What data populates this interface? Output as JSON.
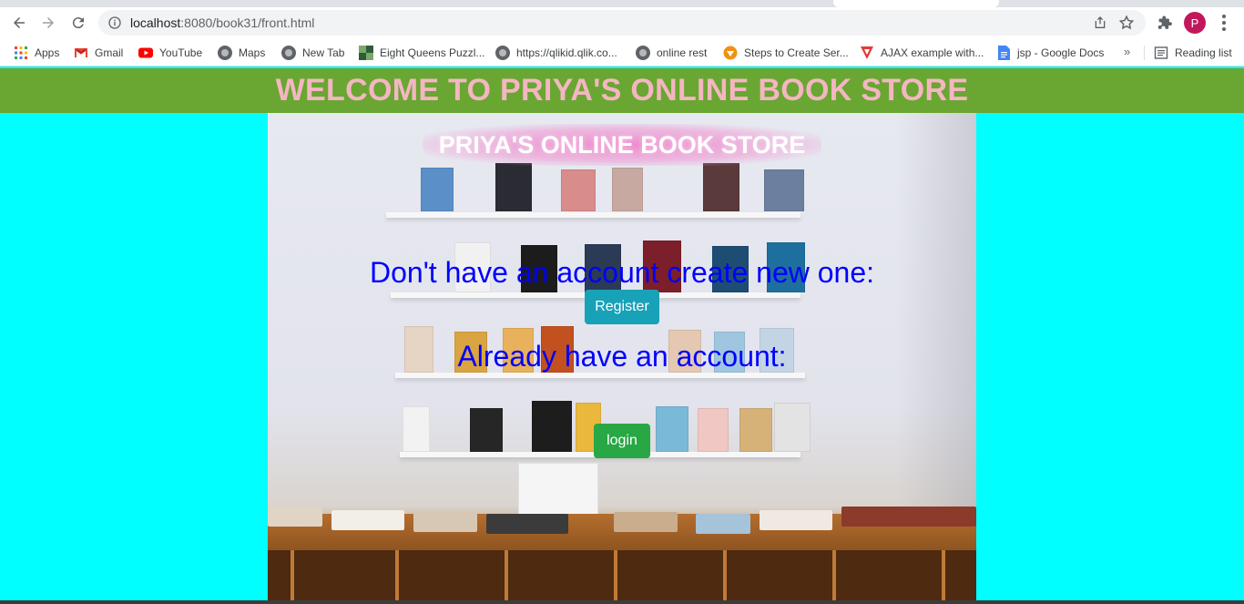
{
  "browser": {
    "url_host": "localhost",
    "url_path": ":8080/book31/front.html",
    "profile_initial": "P"
  },
  "bookmarks": [
    {
      "label": "Apps",
      "icon": "apps-grid-icon"
    },
    {
      "label": "Gmail",
      "icon": "gmail-icon"
    },
    {
      "label": "YouTube",
      "icon": "youtube-icon"
    },
    {
      "label": "Maps",
      "icon": "globe-icon"
    },
    {
      "label": "New Tab",
      "icon": "globe-icon"
    },
    {
      "label": "Eight Queens Puzzl...",
      "icon": "site-icon"
    },
    {
      "label": "https://qlikid.qlik.co...",
      "icon": "globe-icon"
    },
    {
      "label": "online rest",
      "icon": "globe-icon"
    },
    {
      "label": "Steps to Create Ser...",
      "icon": "site-icon"
    },
    {
      "label": "AJAX example with...",
      "icon": "site-icon"
    },
    {
      "label": "jsp - Google Docs",
      "icon": "google-docs-icon"
    }
  ],
  "bookmarks_more": "»",
  "reading_list": "Reading list",
  "page": {
    "banner_title": "WELCOME TO PRIYA'S ONLINE BOOK STORE",
    "hero_title": "PRIYA'S ONLINE BOOK STORE",
    "register_prompt": "Don't have an account create new one:",
    "register_button": "Register",
    "login_prompt": "Already have an account:",
    "login_button": "login"
  },
  "colors": {
    "page_background": "#00ffff",
    "banner_background": "#6aa632",
    "banner_text": "#f4b6c2",
    "prompt_text": "#0000ff",
    "register_button": "#17a2b8",
    "login_button": "#28a745"
  }
}
